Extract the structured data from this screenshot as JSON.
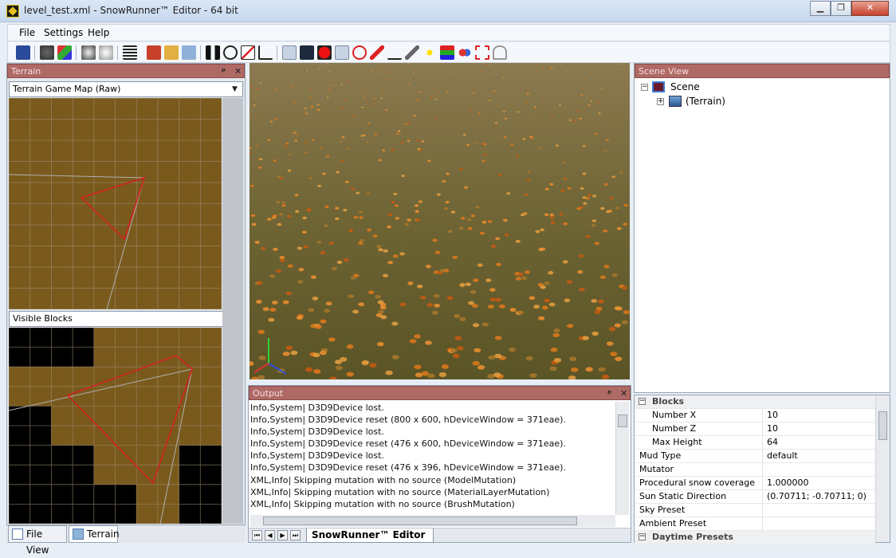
{
  "window": {
    "title": "level_test.xml - SnowRunner™ Editor - 64 bit",
    "controls": {
      "minimize": "▁",
      "maximize": "❐",
      "close": "✕"
    }
  },
  "menu": {
    "items": [
      "File",
      "Settings",
      "Help"
    ]
  },
  "terrain_panel": {
    "title": "Terrain",
    "pin": "ᵖ",
    "close": "✕",
    "map_combo": "Terrain Game Map (Raw)",
    "blocks_combo": "Visible Blocks"
  },
  "left_tabs": [
    "File View",
    "Terrain"
  ],
  "output_panel": {
    "title": "Output",
    "pin": "ᵖ",
    "close": "✕",
    "lines": [
      "Info,System| D3D9Device lost.",
      "Info,System| D3D9Device reset (800 x 600, hDeviceWindow = 371eae).",
      "Info,System| D3D9Device lost.",
      "Info,System| D3D9Device reset (476 x 600, hDeviceWindow = 371eae).",
      "Info,System| D3D9Device lost.",
      "Info,System| D3D9Device reset (476 x 396, hDeviceWindow = 371eae).",
      "XML,Info| Skipping mutation with no source (ModelMutation)",
      "XML,Info| Skipping mutation with no source (MaterialLayerMutation)",
      "XML,Info| Skipping mutation with no source (BrushMutation)"
    ],
    "doc_tab": "SnowRunner™ Editor",
    "nav": [
      "⏮",
      "◀",
      "▶",
      "⏭"
    ]
  },
  "scene_panel": {
    "title": "Scene View",
    "root": "Scene",
    "child": "(Terrain)",
    "root_toggle": "−",
    "child_toggle": "+"
  },
  "properties": {
    "category_blocks": "Blocks",
    "category_daytime": "Daytime Presets",
    "rows": [
      {
        "key": "Number X",
        "value": "10",
        "indent": true
      },
      {
        "key": "Number Z",
        "value": "10",
        "indent": true
      },
      {
        "key": "Max Height",
        "value": "64",
        "indent": true
      },
      {
        "key": "Mud Type",
        "value": "default",
        "indent": false
      },
      {
        "key": "Mutator",
        "value": "",
        "indent": false
      },
      {
        "key": "Procedural snow coverage",
        "value": "1.000000",
        "indent": false
      },
      {
        "key": "Sun Static Direction",
        "value": "(0.70711; -0.70711; 0)",
        "indent": false
      },
      {
        "key": "Sky Preset",
        "value": "",
        "indent": false
      },
      {
        "key": "Ambient Preset",
        "value": "",
        "indent": false
      }
    ]
  },
  "colors": {
    "panel_header": "#b06a66",
    "terrain_brown": "#7a5a1c",
    "frustum_red": "#d42020"
  },
  "blocks_grid": {
    "cols": 5,
    "rows": 5,
    "visible": [
      [
        0,
        0,
        1,
        1,
        1
      ],
      [
        1,
        1,
        1,
        1,
        1
      ],
      [
        0,
        1,
        1,
        1,
        1
      ],
      [
        0,
        0,
        1,
        1,
        0
      ],
      [
        0,
        0,
        0,
        1,
        0
      ]
    ]
  }
}
